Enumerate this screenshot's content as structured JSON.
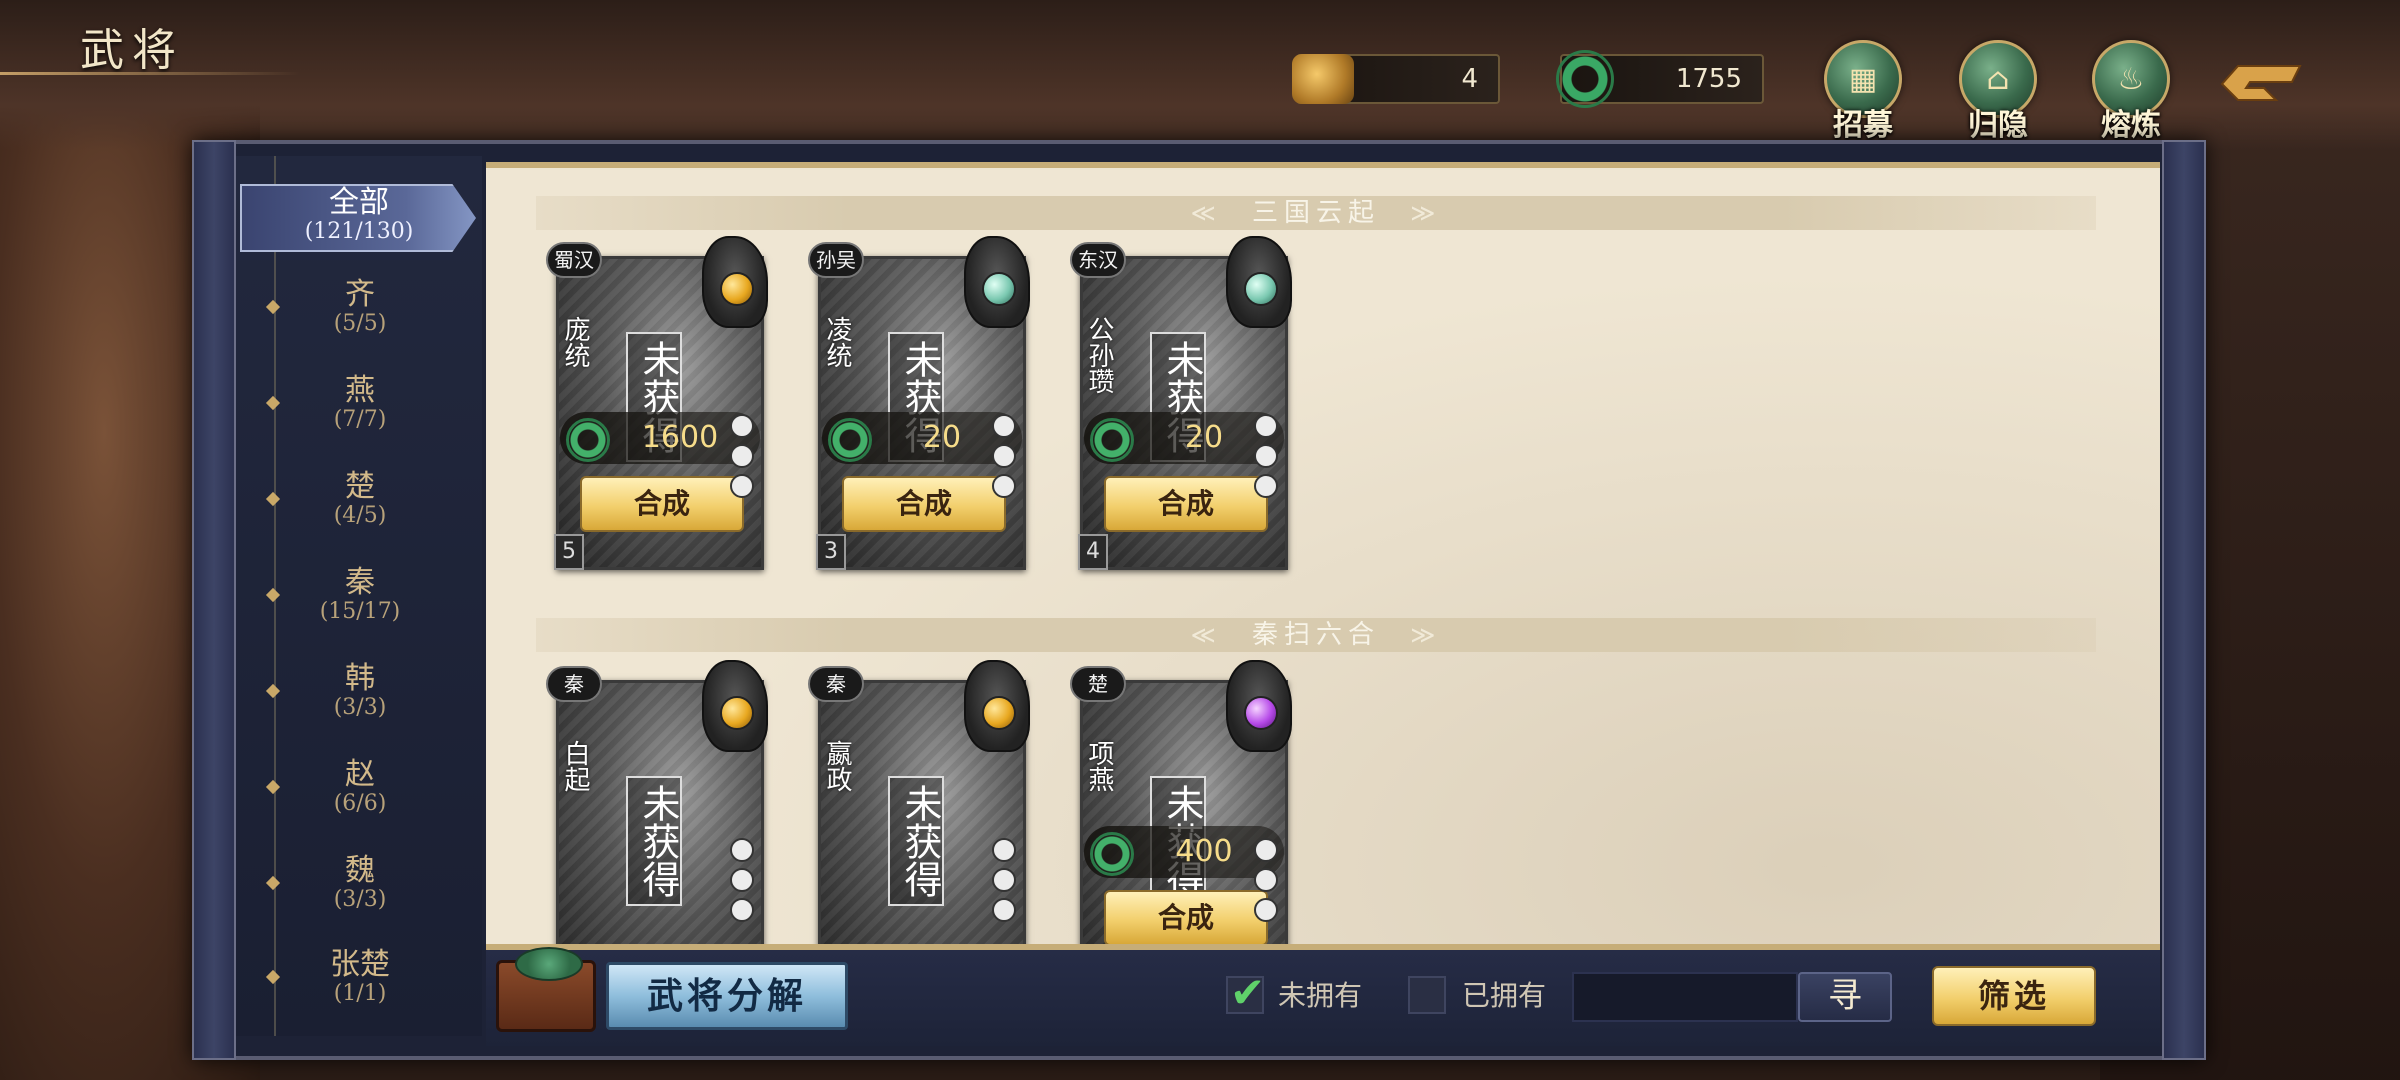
{
  "header": {
    "title": "武将"
  },
  "currencies": [
    {
      "icon": "gold-ingot-icon",
      "value": "4"
    },
    {
      "icon": "jade-ring-icon",
      "value": "1755"
    }
  ],
  "top_buttons": [
    {
      "icon": "recruit-icon",
      "label": "招募"
    },
    {
      "icon": "retire-icon",
      "label": "归隐"
    },
    {
      "icon": "smelt-icon",
      "label": "熔炼"
    }
  ],
  "sidebar": {
    "items": [
      {
        "name": "全部",
        "count": "(121/130)"
      },
      {
        "name": "齐",
        "count": "(5/5)"
      },
      {
        "name": "燕",
        "count": "(7/7)"
      },
      {
        "name": "楚",
        "count": "(4/5)"
      },
      {
        "name": "秦",
        "count": "(15/17)"
      },
      {
        "name": "韩",
        "count": "(3/3)"
      },
      {
        "name": "赵",
        "count": "(6/6)"
      },
      {
        "name": "魏",
        "count": "(3/3)"
      },
      {
        "name": "张楚",
        "count": "(1/1)"
      }
    ]
  },
  "sections": [
    {
      "title": "三国云起",
      "cards": [
        {
          "faction": "蜀汉",
          "name": "庞统",
          "unowned": "未获得",
          "cost": "1600",
          "action": "合成",
          "star": "5",
          "gem": "gold"
        },
        {
          "faction": "孙吴",
          "name": "凌统",
          "unowned": "未获得",
          "cost": "20",
          "action": "合成",
          "star": "3",
          "gem": "teal"
        },
        {
          "faction": "东汉",
          "name": "公孙瓒",
          "unowned": "未获得",
          "cost": "20",
          "action": "合成",
          "star": "4",
          "gem": "teal"
        }
      ]
    },
    {
      "title": "秦扫六合",
      "cards": [
        {
          "faction": "秦",
          "name": "白起",
          "unowned": "未获得",
          "gem": "gold"
        },
        {
          "faction": "秦",
          "name": "嬴政",
          "unowned": "未获得",
          "gem": "gold"
        },
        {
          "faction": "楚",
          "name": "项燕",
          "unowned": "未获得",
          "cost": "400",
          "action": "合成",
          "gem": "purple"
        }
      ]
    }
  ],
  "bottom": {
    "decompose_label": "武将分解",
    "filter_unowned": {
      "label": "未拥有",
      "checked": true
    },
    "filter_owned": {
      "label": "已拥有",
      "checked": false
    },
    "search_value": "",
    "search_button": "寻",
    "filter_button": "筛选"
  }
}
